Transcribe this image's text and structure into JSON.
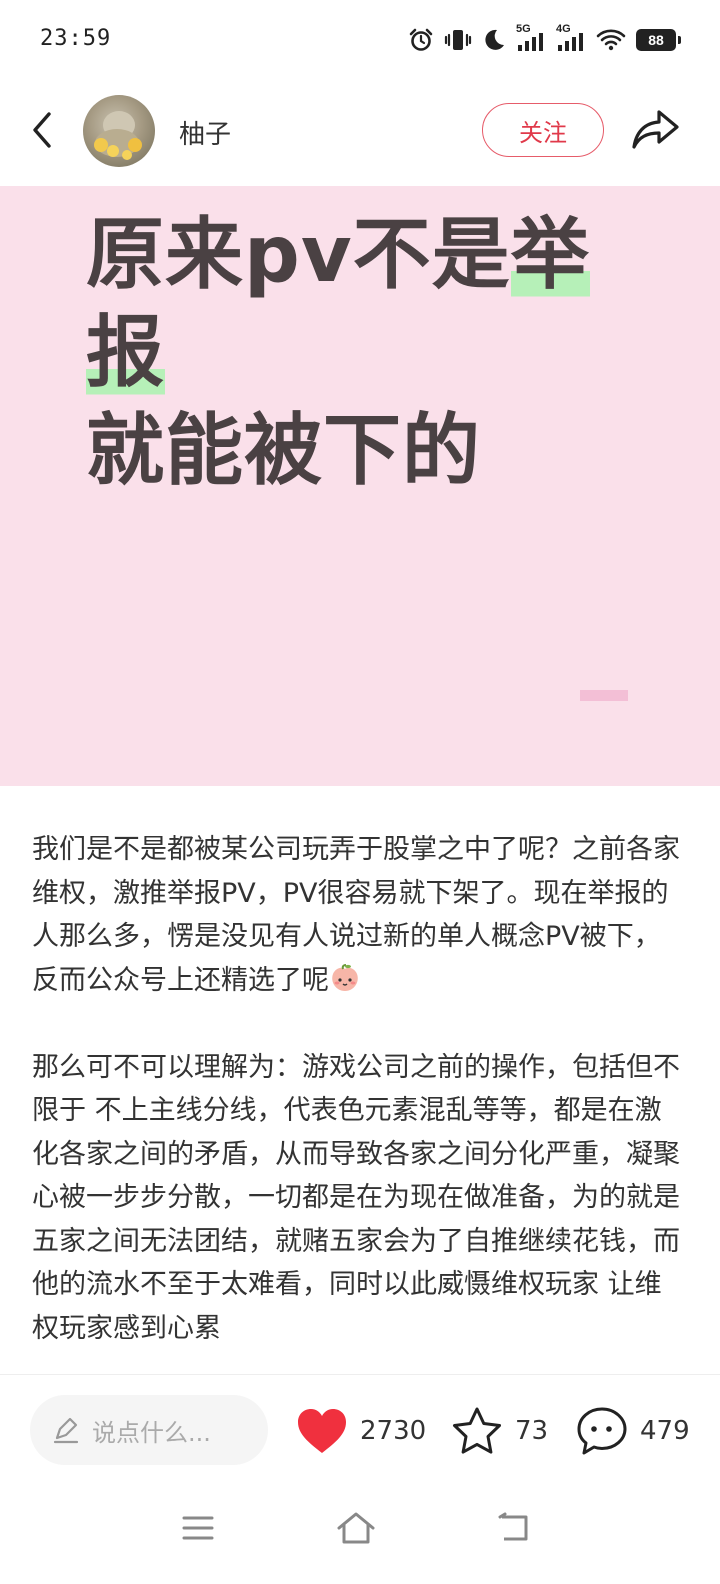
{
  "status_bar": {
    "time": "23:59",
    "network_1": "5G",
    "network_2": "4G",
    "battery": "88"
  },
  "header": {
    "author_name": "柚子",
    "follow_label": "关注"
  },
  "cover": {
    "title_line1_plain": "原来pv不是",
    "title_line1_highlight": "举报",
    "title_line2": "就能被下的",
    "background_color": "#fae0ea",
    "highlight_color": "#b6f0b8"
  },
  "content": {
    "paragraph_1": "我们是不是都被某公司玩弄于股掌之中了呢？之前各家维权，激推举报PV，PV很容易就下架了。现在举报的人那么多，愣是没见有人说过新的单人概念PV被下，反而公众号上还精选了呢",
    "paragraph_2": "那么可不可以理解为：游戏公司之前的操作，包括但不限于 不上主线分线，代表色元素混乱等等，都是在激化各家之间的矛盾，从而导致各家之间分化严重，凝聚心被一步步分散，一切都是在为现在做准备，为的就是五家之间无法团结，就赌五家会为了自推继续花钱，而他的流水不至于太难看，同时以此威慑维权玩家 让维权玩家感到心累"
  },
  "action_bar": {
    "comment_placeholder": "说点什么...",
    "like_count": "2730",
    "favorite_count": "73",
    "comment_count": "479",
    "like_color": "#f0303e"
  },
  "icons": {
    "back": "back-arrow-icon",
    "share": "share-icon",
    "pen": "pen-icon",
    "like": "heart-icon",
    "favorite": "star-icon",
    "comment": "chat-bubble-icon",
    "emoji": "peach-emoji",
    "nav_menu": "menu-icon",
    "nav_home": "home-icon",
    "nav_back": "back-icon"
  }
}
